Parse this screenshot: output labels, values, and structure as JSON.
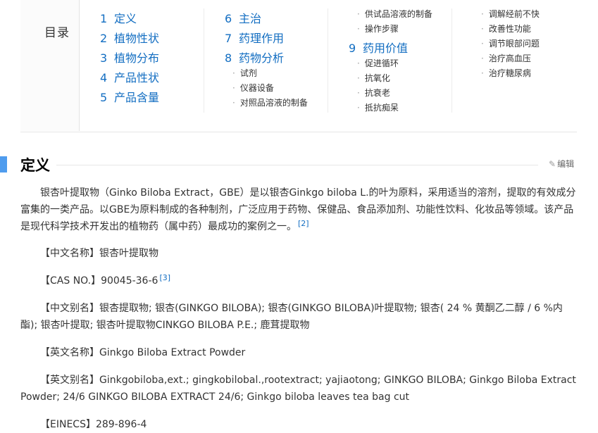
{
  "toc": {
    "title": "目录",
    "col1": [
      {
        "num": "1",
        "label": "定义"
      },
      {
        "num": "2",
        "label": "植物性状"
      },
      {
        "num": "3",
        "label": "植物分布"
      },
      {
        "num": "4",
        "label": "产品性状"
      },
      {
        "num": "5",
        "label": "产品含量"
      }
    ],
    "col2": [
      {
        "num": "6",
        "label": "主治"
      },
      {
        "num": "7",
        "label": "药理作用"
      },
      {
        "num": "8",
        "label": "药物分析"
      }
    ],
    "col2_sub": [
      "试剂",
      "仪器设备",
      "对照品溶液的制备"
    ],
    "col3_sub_top": [
      "供试品溶液的制备",
      "操作步骤"
    ],
    "col3": [
      {
        "num": "9",
        "label": "药用价值"
      }
    ],
    "col3_sub": [
      "促进循环",
      "抗氧化",
      "抗衰老",
      "抵抗痴呆"
    ],
    "col4_sub": [
      "调解经前不快",
      "改善性功能",
      "调节眼部问题",
      "治疗高血压",
      "治疗糖尿病"
    ]
  },
  "section": {
    "title": "定义",
    "edit_label": "编辑"
  },
  "content": {
    "intro": "银杏叶提取物（Ginko Biloba Extract，GBE）是以银杏Ginkgo biloba L.的叶为原料，采用适当的溶剂，提取的有效成分富集的一类产品。以GBE为原料制成的各种制剂，广泛应用于药物、保健品、食品添加剂、功能性饮料、化妆品等领域。该产品是现代科学技术开发出的植物药（属中药）最成功的案例之一。",
    "intro_ref": "[2]",
    "cn_name": "【中文名称】银杏叶提取物",
    "cas": "【CAS NO.】90045-36-6",
    "cas_ref": "[3]",
    "cn_alias": "【中文别名】银杏提取物; 银杏(GINKGO BILOBA); 银杏(GINKGO BILOBA)叶提取物; 银杏( 24 % 黄酮乙二醇 / 6 %内酯); 银杏叶提取; 银杏叶提取物CINKGO BILOBA P.E.; 鹿茸提取物",
    "en_name": "【英文名称】Ginkgo Biloba Extract Powder",
    "en_alias": "【英文别名】Ginkgobiloba,ext.; gingkobilobal.,rootextract; yajiaotong; GINKGO BILOBA; Ginkgo Biloba Extract Powder; 24/6 GINKGO BILOBA EXTRACT 24/6; Ginkgo biloba leaves tea bag cut",
    "einecs": "【EINECS】289-896-4"
  },
  "colors": {
    "link": "#136ec2",
    "accent_bar": "#4f9cee",
    "text": "#333333"
  }
}
